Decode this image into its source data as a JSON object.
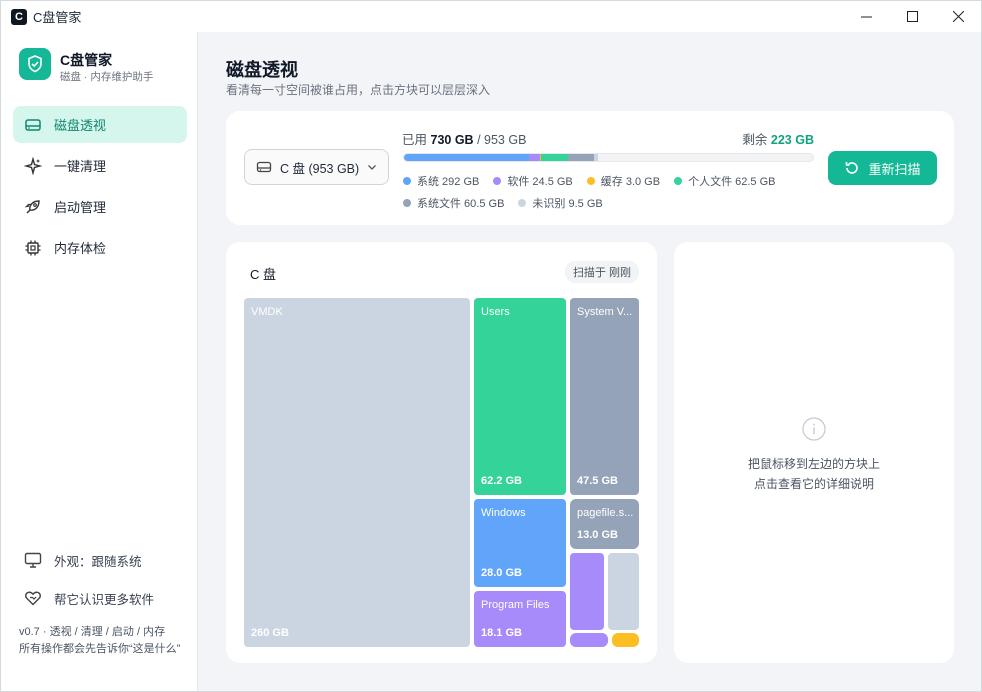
{
  "window": {
    "title": "C盘管家",
    "app_icon_letter": "C"
  },
  "sidebar": {
    "brand_name": "C盘管家",
    "brand_sub": "磁盘 · 内存维护助手",
    "items": [
      {
        "label": "磁盘透视",
        "icon": "drive-icon",
        "active": true
      },
      {
        "label": "一键清理",
        "icon": "sparkle-icon",
        "active": false
      },
      {
        "label": "启动管理",
        "icon": "rocket-icon",
        "active": false
      },
      {
        "label": "内存体检",
        "icon": "chip-icon",
        "active": false
      }
    ],
    "appearance_label": "外观：跟随系统",
    "learn_label": "帮它认识更多软件",
    "version_text": "v0.7 · 透视 / 清理 / 启动 / 内存\n所有操作都会先告诉你“这是什么”"
  },
  "page": {
    "title": "磁盘透视",
    "subtitle": "看清每一寸空间被谁占用，点击方块可以层层深入"
  },
  "summary": {
    "drive_selected": "C 盘 (953 GB)",
    "used_label": "已用",
    "used_value": "730 GB",
    "total_value": "/ 953 GB",
    "free_label": "剩余",
    "free_value": "223 GB",
    "rescan_label": "重新扫描",
    "categories": [
      {
        "label": "系统 292 GB",
        "value_gb": 292,
        "color": "#60a5fa"
      },
      {
        "label": "软件 24.5 GB",
        "value_gb": 24.5,
        "color": "#a78bfa"
      },
      {
        "label": "缓存 3.0 GB",
        "value_gb": 3.0,
        "color": "#fbbf24"
      },
      {
        "label": "个人文件 62.5 GB",
        "value_gb": 62.5,
        "color": "#34d399"
      },
      {
        "label": "系统文件 60.5 GB",
        "value_gb": 60.5,
        "color": "#94a3b8"
      },
      {
        "label": "未识别 9.5 GB",
        "value_gb": 9.5,
        "color": "#cbd5e1"
      }
    ],
    "total_gb": 953
  },
  "treemap": {
    "title": "C 盘",
    "scan_badge": "扫描于 刚刚",
    "tiles": [
      {
        "name": "VMDK",
        "size": "260 GB",
        "color": "#cbd5e1"
      },
      {
        "name": "Users",
        "size": "62.2 GB",
        "color": "#34d399"
      },
      {
        "name": "System V...",
        "size": "47.5 GB",
        "color": "#94a3b8"
      },
      {
        "name": "Windows",
        "size": "28.0 GB",
        "color": "#60a5fa"
      },
      {
        "name": "pagefile.s...",
        "size": "13.0 GB",
        "color": "#94a3b8"
      },
      {
        "name": "Program Files",
        "size": "18.1 GB",
        "color": "#a78bfa"
      },
      {
        "name": "",
        "size": "",
        "color": "#a78bfa"
      },
      {
        "name": "",
        "size": "",
        "color": "#cbd5e1"
      },
      {
        "name": "",
        "size": "",
        "color": "#a78bfa"
      },
      {
        "name": "",
        "size": "",
        "color": "#fbbf24"
      }
    ]
  },
  "detail": {
    "hint_line1": "把鼠标移到左边的方块上",
    "hint_line2": "点击查看它的详细说明"
  }
}
